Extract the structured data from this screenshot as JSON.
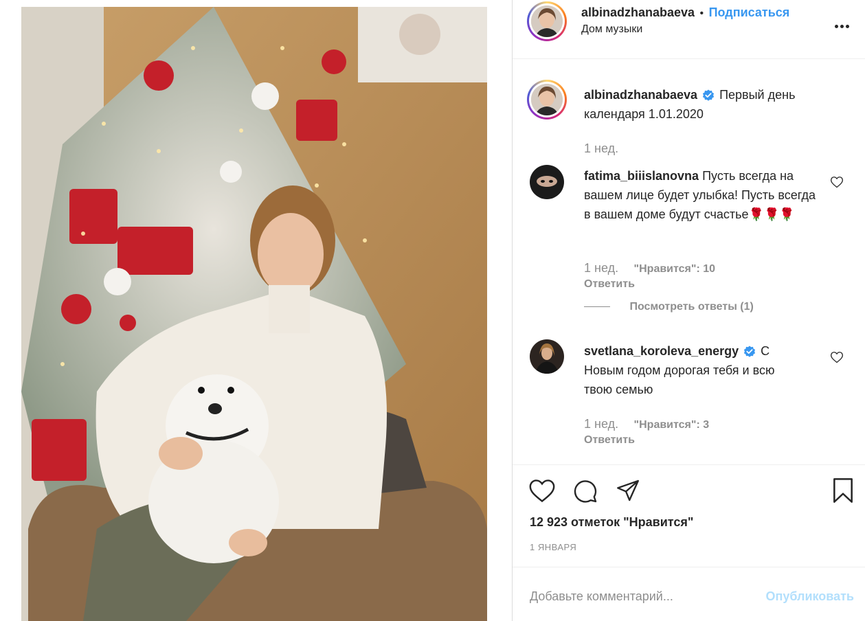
{
  "post": {
    "username": "albinadzhanabaeva",
    "separator": "•",
    "follow_label": "Подписаться",
    "location": "Дом музыки"
  },
  "caption": {
    "username": "albinadzhanabaeva",
    "text": "Первый день календаря 1.01.2020",
    "time": "1 нед."
  },
  "comments": [
    {
      "username": "fatima_biiislanovna",
      "text": "Пусть всегда на вашем лице будет улыбка! Пусть всегда в вашем доме будут счастье🌹🌹🌹",
      "time": "1 нед.",
      "likes": "\"Нравится\": 10",
      "reply_label": "Ответить",
      "view_replies": "Посмотреть ответы (1)"
    },
    {
      "username": "svetlana_koroleva_energy",
      "text": "С Новым годом дорогая тебя и всю твою семью",
      "time": "1 нед.",
      "likes": "\"Нравится\": 3",
      "reply_label": "Ответить"
    }
  ],
  "likes_count": "12 923 отметок \"Нравится\"",
  "date": "1 ЯНВАРЯ",
  "comment_input": {
    "placeholder": "Добавьте комментарий...",
    "publish_label": "Опубликовать"
  },
  "colors": {
    "link_blue": "#3897f0",
    "publish_disabled": "#b2dffc",
    "muted": "#8e8e8e",
    "verified": "#3897f0"
  },
  "icons": [
    "more-options-icon",
    "verified-icon",
    "heart-icon",
    "comment-icon",
    "share-icon",
    "bookmark-icon"
  ]
}
